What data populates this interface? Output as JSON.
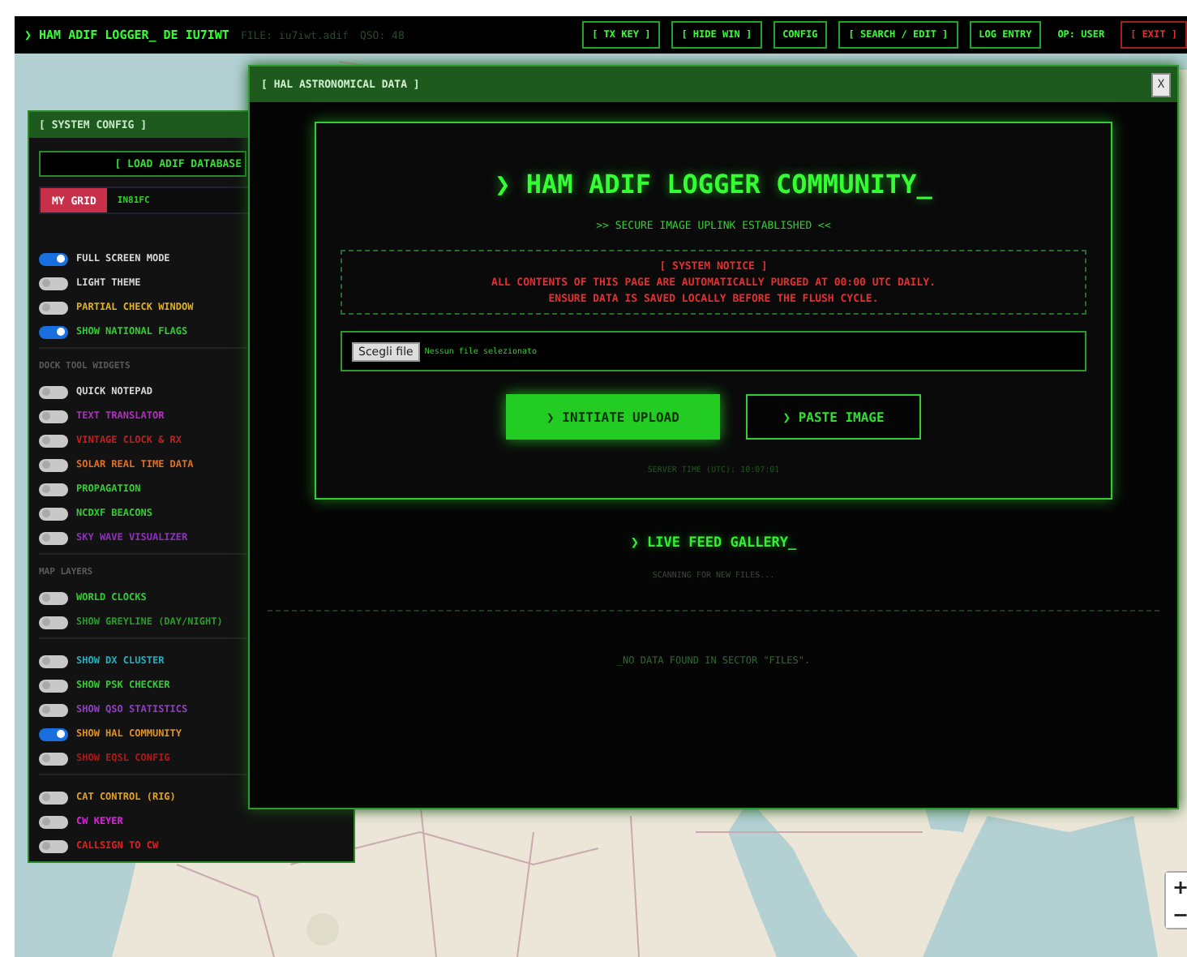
{
  "topbar": {
    "title": "❯ HAM ADIF LOGGER_ DE IU7IWT",
    "file": "FILE: iu7iwt.adif",
    "qso": "QSO: 48",
    "buttons": [
      {
        "label": "[ TX KEY ]",
        "kind": "normal"
      },
      {
        "label": "[ HIDE WIN ]",
        "kind": "normal"
      },
      {
        "label": "CONFIG",
        "kind": "normal"
      },
      {
        "label": "[ SEARCH / EDIT ]",
        "kind": "normal"
      },
      {
        "label": "LOG ENTRY",
        "kind": "normal"
      },
      {
        "label": "OP: USER",
        "kind": "plain"
      },
      {
        "label": "[ EXIT ]",
        "kind": "danger"
      }
    ]
  },
  "sidebar": {
    "title": "[ SYSTEM CONFIG ]",
    "load_button": "[ LOAD ADIF DATABASE",
    "grid_label": "MY GRID",
    "grid_value": "IN81FC",
    "sections": [
      {
        "items": [
          {
            "label": "FULL SCREEN MODE",
            "on": true,
            "color": "#d8d8d8"
          },
          {
            "label": "LIGHT THEME",
            "on": false,
            "color": "#d8d8d8"
          },
          {
            "label": "PARTIAL CHECK WINDOW",
            "on": false,
            "color": "#e0b020"
          },
          {
            "label": "SHOW NATIONAL FLAGS",
            "on": true,
            "color": "#33cc33"
          }
        ]
      },
      {
        "heading": "DOCK TOOL WIDGETS",
        "items": [
          {
            "label": "QUICK NOTEPAD",
            "on": false,
            "color": "#d8d8d8"
          },
          {
            "label": "TEXT TRANSLATOR",
            "on": false,
            "color": "#b030c0"
          },
          {
            "label": "VINTAGE CLOCK & RX",
            "on": false,
            "color": "#c02020"
          },
          {
            "label": "SOLAR REAL TIME DATA",
            "on": false,
            "color": "#e07020"
          },
          {
            "label": "PROPAGATION",
            "on": false,
            "color": "#33cc33"
          },
          {
            "label": "NCDXF BEACONS",
            "on": false,
            "color": "#33cc33"
          },
          {
            "label": "SKY WAVE VISUALIZER",
            "on": false,
            "color": "#9030c0"
          }
        ]
      },
      {
        "heading": "MAP LAYERS",
        "items": [
          {
            "label": "WORLD CLOCKS",
            "on": false,
            "color": "#33cc33"
          },
          {
            "label": "SHOW GREYLINE (DAY/NIGHT)",
            "on": false,
            "color": "#2a9a2a"
          }
        ]
      },
      {
        "items": [
          {
            "label": "SHOW DX CLUSTER",
            "on": false,
            "color": "#20b0c0"
          },
          {
            "label": "SHOW PSK CHECKER",
            "on": false,
            "color": "#33cc33"
          },
          {
            "label": "SHOW QSO STATISTICS",
            "on": false,
            "color": "#9040c0"
          },
          {
            "label": "SHOW HAL COMMUNITY",
            "on": true,
            "color": "#e09020"
          },
          {
            "label": "SHOW EQSL CONFIG",
            "on": false,
            "color": "#b01818"
          }
        ]
      },
      {
        "items": [
          {
            "label": "CAT CONTROL (RIG)",
            "on": false,
            "color": "#e0a020"
          },
          {
            "label": "CW KEYER",
            "on": false,
            "color": "#e020e0"
          },
          {
            "label": "CALLSIGN TO CW",
            "on": false,
            "color": "#e02020"
          }
        ]
      }
    ]
  },
  "modal": {
    "title": "[ HAL ASTRONOMICAL DATA ]",
    "close": "X",
    "heading": "❯ HAM ADIF LOGGER COMMUNITY_",
    "subtitle": ">> SECURE IMAGE UPLINK ESTABLISHED <<",
    "notice": {
      "title": "[ SYSTEM NOTICE ]",
      "lines": [
        "ALL CONTENTS OF THIS PAGE ARE AUTOMATICALLY PURGED AT 00:00 UTC DAILY.",
        "ENSURE DATA IS SAVED LOCALLY BEFORE THE FLUSH CYCLE."
      ]
    },
    "file_button": "Scegli file",
    "file_status": "Nessun file selezionato",
    "upload_button": "❯ INITIATE UPLOAD",
    "paste_button": "❯ PASTE IMAGE",
    "server_time": "SERVER TIME (UTC): 10:07:01",
    "gallery_title": "❯ LIVE FEED GALLERY_",
    "scanning": "SCANNING FOR NEW FILES...",
    "empty": "_NO DATA FOUND IN SECTOR \"FILES\"."
  },
  "map": {
    "kind": "picture",
    "zoom": [
      "+",
      "−"
    ]
  }
}
